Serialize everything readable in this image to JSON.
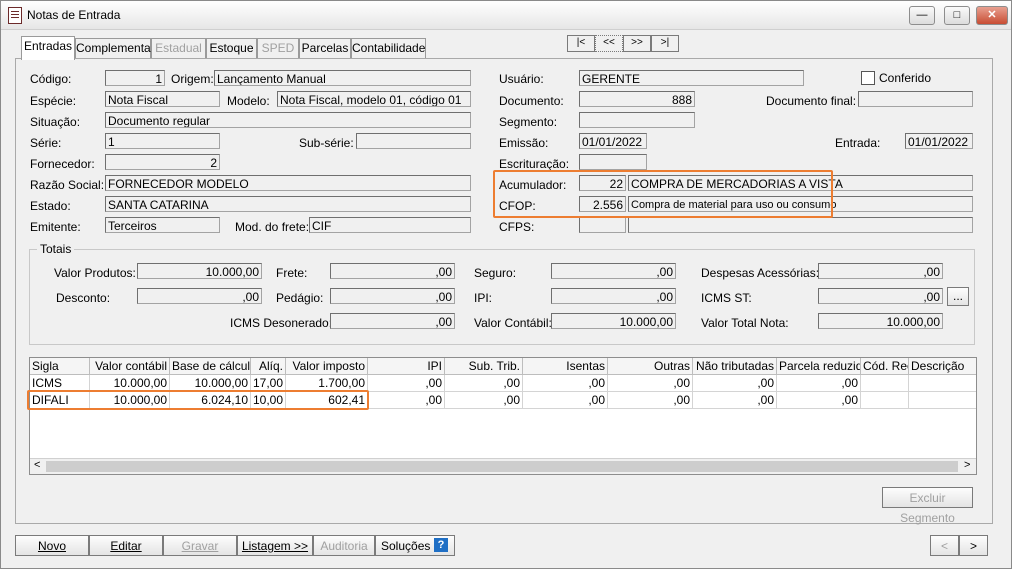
{
  "window": {
    "title": "Notas de Entrada"
  },
  "tabs": [
    {
      "label": "Entradas",
      "active": true,
      "disabled": false
    },
    {
      "label": "Complementar",
      "active": false,
      "disabled": false
    },
    {
      "label": "Estadual",
      "active": false,
      "disabled": true
    },
    {
      "label": "Estoque",
      "active": false,
      "disabled": false
    },
    {
      "label": "SPED",
      "active": false,
      "disabled": true
    },
    {
      "label": "Parcelas",
      "active": false,
      "disabled": false
    },
    {
      "label": "Contabilidade",
      "active": false,
      "disabled": false
    }
  ],
  "record_nav": {
    "first": "|<",
    "prev": "<<",
    "next": ">>",
    "last": ">|"
  },
  "form": {
    "codigo_label": "Código:",
    "codigo": "1",
    "origem_label": "Origem:",
    "origem": "Lançamento Manual",
    "especie_label": "Espécie:",
    "especie": "Nota Fiscal",
    "modelo_label": "Modelo:",
    "modelo": "Nota Fiscal, modelo 01, código 01",
    "situacao_label": "Situação:",
    "situacao": "Documento regular",
    "serie_label": "Série:",
    "serie": "1",
    "subserie_label": "Sub-série:",
    "subserie": "",
    "fornecedor_label": "Fornecedor:",
    "fornecedor": "2",
    "razao_label": "Razão Social:",
    "razao": "FORNECEDOR MODELO",
    "estado_label": "Estado:",
    "estado": "SANTA CATARINA",
    "emitente_label": "Emitente:",
    "emitente": "Terceiros",
    "frete_label": "Mod. do frete:",
    "frete": "CIF",
    "usuario_label": "Usuário:",
    "usuario": "GERENTE",
    "conferido_label": "Conferido",
    "documento_label": "Documento:",
    "documento": "888",
    "docfinal_label": "Documento final:",
    "docfinal": "",
    "segmento_label": "Segmento:",
    "segmento": "",
    "emissao_label": "Emissão:",
    "emissao": "01/01/2022",
    "entrada_label": "Entrada:",
    "entrada": "01/01/2022",
    "escrituracao_label": "Escrituração:",
    "escrituracao": "",
    "acumulador_label": "Acumulador:",
    "acumulador_code": "22",
    "acumulador_desc": "COMPRA DE MERCADORIAS A VISTA",
    "cfop_label": "CFOP:",
    "cfop_code": "2.556",
    "cfop_desc": "Compra de material para uso ou consumo",
    "cfps_label": "CFPS:",
    "cfps_code": "",
    "cfps_desc": ""
  },
  "totais": {
    "title": "Totais",
    "valor_produtos_label": "Valor Produtos:",
    "valor_produtos": "10.000,00",
    "frete_label": "Frete:",
    "frete": ",00",
    "seguro_label": "Seguro:",
    "seguro": ",00",
    "despesas_label": "Despesas Acessórias:",
    "despesas": ",00",
    "desconto_label": "Desconto:",
    "desconto": ",00",
    "pedagio_label": "Pedágio:",
    "pedagio": ",00",
    "ipi_label": "IPI:",
    "ipi": ",00",
    "icms_st_label": "ICMS ST:",
    "icms_st": ",00",
    "ellipsis": "...",
    "icms_deson_label": "ICMS Desonerado:",
    "icms_deson": ",00",
    "valor_contabil_label": "Valor Contábil:",
    "valor_contabil": "10.000,00",
    "valor_total_label": "Valor Total Nota:",
    "valor_total": "10.000,00"
  },
  "grid": {
    "headers": [
      "Sigla",
      "Valor contábil",
      "Base de cálculo",
      "Alíq.",
      "Valor imposto",
      "IPI",
      "Sub. Trib.",
      "Isentas",
      "Outras",
      "Não tributadas",
      "Parcela reduzida",
      "Cód. Rec.",
      "Descrição"
    ],
    "rows": [
      [
        "ICMS",
        "10.000,00",
        "10.000,00",
        "17,00",
        "1.700,00",
        ",00",
        ",00",
        ",00",
        ",00",
        ",00",
        ",00",
        "",
        ""
      ],
      [
        "DIFALI",
        "10.000,00",
        "6.024,10",
        "10,00",
        "602,41",
        ",00",
        ",00",
        ",00",
        ",00",
        ",00",
        ",00",
        "",
        ""
      ]
    ],
    "scroll_left": "<",
    "scroll_right": ">"
  },
  "buttons": {
    "excluir_segmento": "Excluir Segmento",
    "novo": "Novo",
    "editar": "Editar",
    "gravar": "Gravar",
    "listagem": "Listagem >>",
    "auditoria": "Auditoria",
    "solucoes": "Soluções",
    "help": "?",
    "prev": "<",
    "next": ">"
  },
  "colors": {
    "highlight": "#ed7d31"
  }
}
